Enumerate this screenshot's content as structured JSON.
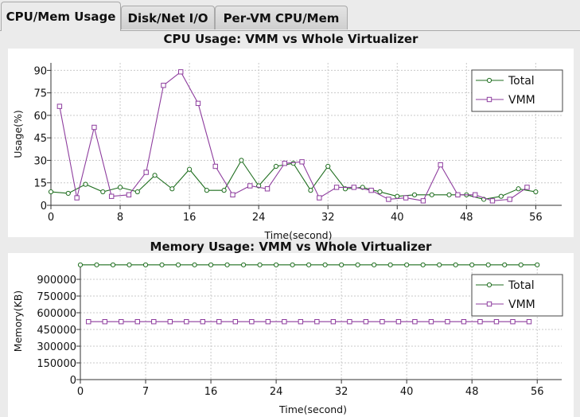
{
  "tabs": [
    {
      "label": "CPU/Mem Usage",
      "active": true
    },
    {
      "label": "Disk/Net I/O",
      "active": false
    },
    {
      "label": "Per-VM CPU/Mem",
      "active": false
    }
  ],
  "colors": {
    "total": "#1f6e1f",
    "vmm": "#8e3d9e",
    "plot_bg": "#ffffff",
    "grid": "#c9c9c9"
  },
  "chart_data": [
    {
      "type": "line",
      "title": "CPU Usage: VMM vs Whole Virtualizer",
      "xlabel": "Time(second)",
      "ylabel": "Usage(%)",
      "xlim": [
        0,
        59
      ],
      "ylim": [
        0,
        95
      ],
      "xticks": [
        0,
        8,
        16,
        24,
        32,
        40,
        48,
        56
      ],
      "yticks": [
        0,
        15,
        30,
        45,
        60,
        75,
        90
      ],
      "grid": true,
      "legend_position": "top-right",
      "series": [
        {
          "name": "Total",
          "color": "#1f6e1f",
          "marker": "circle",
          "x": [
            0,
            2,
            4,
            6,
            8,
            10,
            12,
            14,
            16,
            18,
            20,
            22,
            24,
            26,
            28,
            30,
            32,
            34,
            36,
            38,
            40,
            42,
            44,
            46,
            48,
            50,
            52,
            54,
            56
          ],
          "y": [
            9,
            8,
            14,
            9,
            12,
            9,
            20,
            11,
            24,
            10,
            10,
            30,
            13,
            26,
            28,
            10,
            26,
            11,
            12,
            9,
            6,
            7,
            7,
            7,
            7,
            4,
            6,
            11,
            9
          ]
        },
        {
          "name": "VMM",
          "color": "#8e3d9e",
          "marker": "square",
          "x": [
            1,
            3,
            5,
            7,
            9,
            11,
            13,
            15,
            17,
            19,
            21,
            23,
            25,
            27,
            29,
            31,
            33,
            35,
            37,
            39,
            41,
            43,
            45,
            47,
            49,
            51,
            53,
            55
          ],
          "y": [
            66,
            5,
            52,
            6,
            7,
            22,
            80,
            89,
            68,
            26,
            7,
            13,
            11,
            28,
            29,
            5,
            12,
            12,
            10,
            4,
            5,
            3,
            27,
            7,
            7,
            3,
            4,
            12
          ]
        }
      ]
    },
    {
      "type": "line",
      "title": "Memory Usage: VMM vs Whole Virtualizer",
      "xlabel": "Time(second)",
      "ylabel": "Memory(KB)",
      "xlim": [
        0,
        59
      ],
      "ylim": [
        0,
        1050000
      ],
      "xticks": [
        0,
        8,
        16,
        24,
        32,
        40,
        48,
        56
      ],
      "yticks": [
        0,
        150000,
        300000,
        450000,
        600000,
        750000,
        900000
      ],
      "xtick_labels": [
        "0",
        "7",
        "16",
        "24",
        "32",
        "40",
        "48",
        "56"
      ],
      "ytick_labels": [
        "0",
        "150000",
        "300000",
        "450000",
        "600000",
        "750000",
        "900000"
      ],
      "grid": true,
      "legend_position": "top-right",
      "series": [
        {
          "name": "Total",
          "color": "#1f6e1f",
          "marker": "circle",
          "x": [
            0,
            2,
            4,
            6,
            8,
            10,
            12,
            14,
            16,
            18,
            20,
            22,
            24,
            26,
            28,
            30,
            32,
            34,
            36,
            38,
            40,
            42,
            44,
            46,
            48,
            50,
            52,
            54,
            56
          ],
          "y": [
            1030000,
            1030000,
            1030000,
            1030000,
            1030000,
            1030000,
            1030000,
            1030000,
            1030000,
            1030000,
            1030000,
            1030000,
            1030000,
            1030000,
            1030000,
            1030000,
            1030000,
            1030000,
            1030000,
            1030000,
            1030000,
            1030000,
            1030000,
            1030000,
            1030000,
            1030000,
            1030000,
            1030000,
            1030000
          ]
        },
        {
          "name": "VMM",
          "color": "#8e3d9e",
          "marker": "square",
          "x": [
            1,
            3,
            5,
            7,
            9,
            11,
            13,
            15,
            17,
            19,
            21,
            23,
            25,
            27,
            29,
            31,
            33,
            35,
            37,
            39,
            41,
            43,
            45,
            47,
            49,
            51,
            53,
            55
          ],
          "y": [
            520000,
            520000,
            520000,
            520000,
            520000,
            520000,
            520000,
            520000,
            520000,
            520000,
            520000,
            520000,
            520000,
            520000,
            520000,
            520000,
            520000,
            520000,
            520000,
            520000,
            520000,
            520000,
            520000,
            520000,
            520000,
            520000,
            520000,
            520000
          ]
        }
      ]
    }
  ]
}
